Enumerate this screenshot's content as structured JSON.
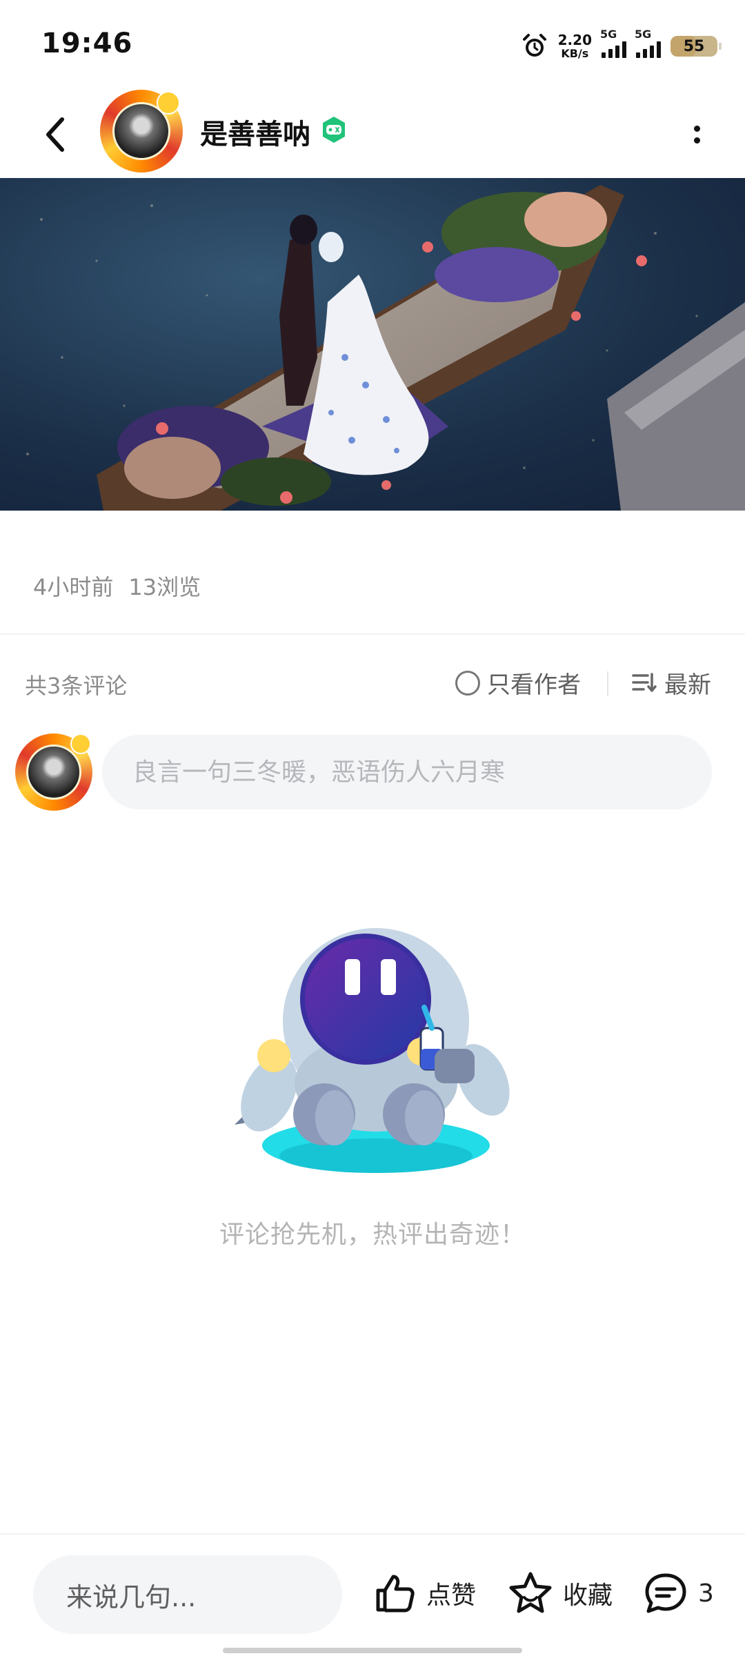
{
  "status_bar": {
    "time": "19:46",
    "net_speed_value": "2.20",
    "net_speed_unit": "KB/s",
    "sim1_label": "5G",
    "sim2_label": "5G",
    "battery_level": "55",
    "battery_fraction": 0.55,
    "icons": [
      "alarm-icon",
      "signal-icon",
      "signal-icon",
      "battery-icon"
    ]
  },
  "header": {
    "username": "是善善呐",
    "icons": [
      "back-arrow-icon",
      "verified-game-badge-icon",
      "more-vertical-icon"
    ]
  },
  "post": {
    "time_ago": "4小时前",
    "views": "13浏览"
  },
  "comments": {
    "count_text": "共3条评论",
    "only_author_label": "只看作者",
    "sort_label": "最新",
    "input_placeholder": "良言一句三冬暖，恶语伤人六月寒",
    "empty_text": "评论抢先机，热评出奇迹！"
  },
  "bottom_bar": {
    "reply_placeholder": "来说几句...",
    "like_label": "点赞",
    "favorite_label": "收藏",
    "comment_count": "3",
    "icons": [
      "thumbs-up-icon",
      "star-icon",
      "comment-bubble-icon"
    ]
  },
  "colors": {
    "accent_green": "#1fc37a",
    "text_muted": "#8b8b8b",
    "input_bg": "#f4f5f7"
  }
}
